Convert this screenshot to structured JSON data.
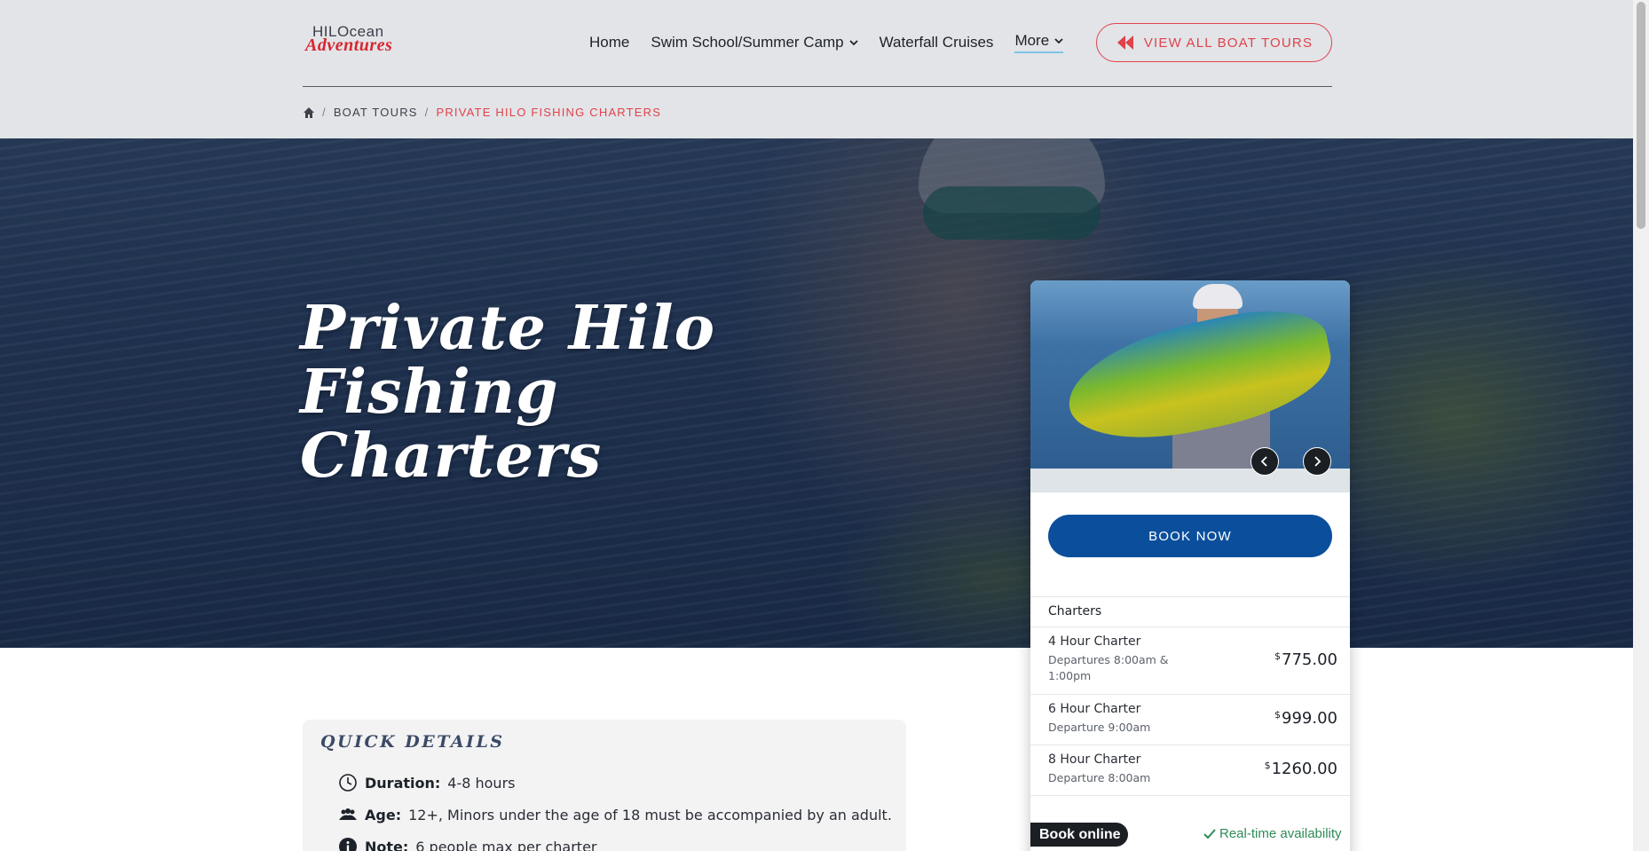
{
  "brand": {
    "logo_top": "HILOcean",
    "logo_bottom": "Adventures"
  },
  "nav": {
    "items": [
      {
        "label": "Home"
      },
      {
        "label": "Swim School/Summer Camp"
      },
      {
        "label": "Waterfall Cruises"
      },
      {
        "label": "More"
      }
    ],
    "cta_label": "VIEW ALL BOAT TOURS"
  },
  "breadcrumb": {
    "items": [
      "BOAT TOURS",
      "PRIVATE HILO FISHING CHARTERS"
    ]
  },
  "hero": {
    "title": "Private Hilo Fishing Charters"
  },
  "booking": {
    "book_now_label": "BOOK NOW",
    "section_label": "Charters",
    "charters": [
      {
        "name": "4 Hour Charter",
        "detail": "Departures 8:00am & 1:00pm",
        "currency": "$",
        "price": "775.00"
      },
      {
        "name": "6 Hour Charter",
        "detail": "Departure 9:00am",
        "currency": "$",
        "price": "999.00"
      },
      {
        "name": "8 Hour Charter",
        "detail": "Departure 8:00am",
        "currency": "$",
        "price": "1260.00"
      }
    ],
    "book_online_label": "Book online",
    "realtime_label": "Real-time availability"
  },
  "quick_details": {
    "title": "QUICK DETAILS",
    "items": [
      {
        "icon": "clock-icon",
        "label": "Duration:",
        "value": "4-8 hours"
      },
      {
        "icon": "group-icon",
        "label": "Age:",
        "value": "12+, Minors under the age of 18 must be accompanied by an adult."
      },
      {
        "icon": "info-icon",
        "label": "Note:",
        "value": "6 people max per charter"
      }
    ]
  },
  "colors": {
    "accent_red": "#e0434a",
    "book_blue": "#0b4f9c",
    "realtime_green": "#2e8b57"
  }
}
